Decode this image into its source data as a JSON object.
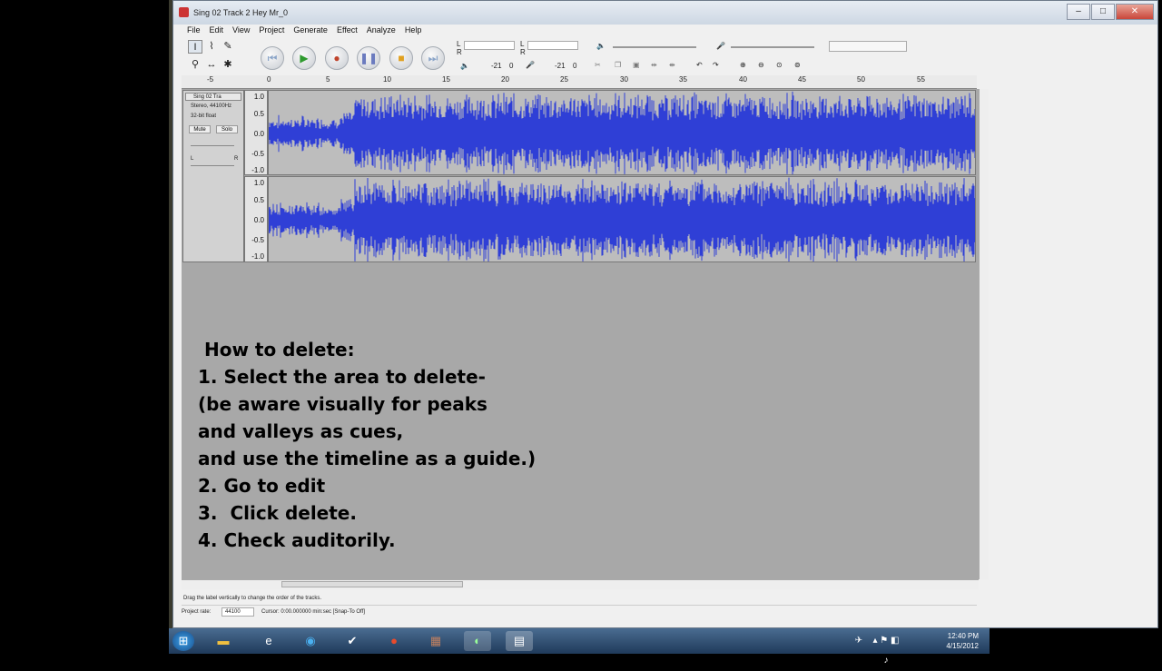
{
  "window": {
    "title": "Sing 02 Track 2 Hey Mr_0",
    "buttons": [
      "–",
      "□",
      "✕"
    ]
  },
  "menu": [
    "File",
    "Edit",
    "View",
    "Project",
    "Generate",
    "Effect",
    "Analyze",
    "Help"
  ],
  "meters": {
    "play_l": "L",
    "play_r": "R",
    "rec_l": "L",
    "rec_r": "R",
    "db1": "-21",
    "zero1": "0",
    "db2": "-21",
    "zero2": "0"
  },
  "ruler_ticks": [
    "-5",
    "0",
    "5",
    "10",
    "15",
    "20",
    "25",
    "30",
    "35",
    "40",
    "45",
    "50",
    "55"
  ],
  "track": {
    "name": "Sing 02 Tra",
    "format": "Stereo, 44100Hz",
    "bits": "32-bit float",
    "mute": "Mute",
    "solo": "Solo",
    "pan_l": "L",
    "pan_r": "R",
    "scale": [
      "1.0",
      "0.5",
      "0.0",
      "-0.5",
      "-1.0"
    ]
  },
  "instructions": [
    " How to delete:",
    "1. Select the area to delete-",
    "(be aware visually for peaks",
    "and valleys as cues,",
    "and use the timeline as a guide.)",
    "2. Go to edit",
    "3.  Click delete.",
    "4. Check auditorily."
  ],
  "status": {
    "hint": "Drag the label vertically to change the order of the tracks.",
    "rate_label": "Project rate:",
    "rate_value": "44100",
    "cursor": "Cursor: 0:00.000000 min:sec  [Snap-To Off]"
  },
  "clock": {
    "time": "12:40 PM",
    "date": "4/15/2012"
  },
  "colors": {
    "waveform": "#2f3fd6",
    "track_bg": "#bdbdbd"
  }
}
